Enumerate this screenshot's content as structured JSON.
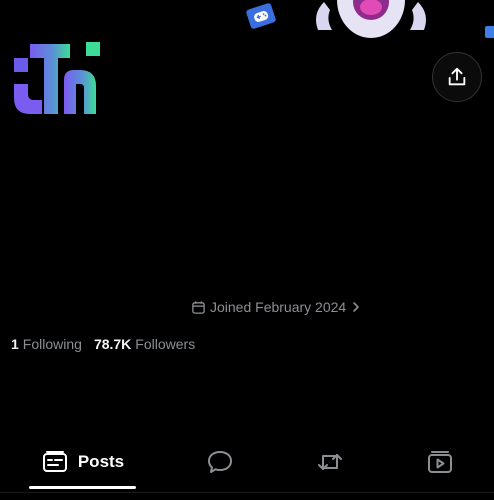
{
  "profile": {
    "joined_text": "Joined February 2024",
    "following_count": "1",
    "following_label": "Following",
    "followers_count": "78.7K",
    "followers_label": "Followers"
  },
  "icons": {
    "share": "share-upload-icon",
    "calendar": "calendar-icon",
    "chevron": "chevron-right-icon",
    "posts": "posts-list-icon",
    "replies": "speech-bubble-icon",
    "reposts": "repost-icon",
    "videos": "video-play-icon"
  },
  "tabs": {
    "posts_label": "Posts"
  },
  "colors": {
    "background": "#000000",
    "muted_text": "#8b8f94",
    "primary_text": "#ffffff",
    "logo_purple": "#7b5cf0",
    "logo_green": "#3ddc97",
    "gamepad_blue": "#3b6fe0"
  }
}
